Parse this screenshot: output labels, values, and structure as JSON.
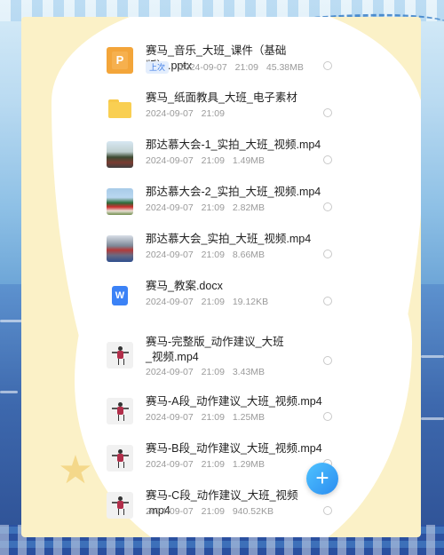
{
  "files": [
    {
      "name": "赛马_音乐_大班_课件（基础版）.pptx",
      "tag": "上次",
      "date": "2024-09-07",
      "time": "21:09",
      "size": "45.38MB",
      "icon": "ppt-icon"
    },
    {
      "name": "赛马_纸面教具_大班_电子素材",
      "tag": "",
      "date": "2024-09-07",
      "time": "21:09",
      "size": "",
      "icon": "folder-icon"
    },
    {
      "name": "那达慕大会-1_实拍_大班_视频.mp4",
      "tag": "",
      "date": "2024-09-07",
      "time": "21:09",
      "size": "1.49MB",
      "icon": "video-thumb"
    },
    {
      "name": "那达慕大会-2_实拍_大班_视频.mp4",
      "tag": "",
      "date": "2024-09-07",
      "time": "21:09",
      "size": "2.82MB",
      "icon": "video-thumb"
    },
    {
      "name": "那达慕大会_实拍_大班_视频.mp4",
      "tag": "",
      "date": "2024-09-07",
      "time": "21:09",
      "size": "8.66MB",
      "icon": "video-thumb"
    },
    {
      "name": "赛马_教案.docx",
      "tag": "",
      "date": "2024-09-07",
      "time": "21:09",
      "size": "19.12KB",
      "icon": "docx-icon"
    },
    {
      "name": "赛马-完整版_动作建议_大班_视频.mp4",
      "tag": "",
      "date": "2024-09-07",
      "time": "21:09",
      "size": "3.43MB",
      "icon": "video-thumb"
    },
    {
      "name": "赛马-A段_动作建议_大班_视频.mp4",
      "tag": "",
      "date": "2024-09-07",
      "time": "21:09",
      "size": "1.25MB",
      "icon": "video-thumb"
    },
    {
      "name": "赛马-B段_动作建议_大班_视频.mp4",
      "tag": "",
      "date": "2024-09-07",
      "time": "21:09",
      "size": "1.29MB",
      "icon": "video-thumb"
    },
    {
      "name": "赛马-C段_动作建议_大班_视频 .mp4",
      "tag": "",
      "date": "2024-09-07",
      "time": "21:09",
      "size": "940.52KB",
      "icon": "video-thumb"
    }
  ],
  "fab": {
    "label": "+",
    "icon": "plus-icon"
  },
  "icon_letters": {
    "ppt": "P",
    "docx": "W"
  },
  "colors": {
    "accent": "#2b8cf0",
    "tag_bg": "#e4eefd",
    "tag_text": "#3b7be6",
    "card_bg": "#fbf1c7"
  }
}
